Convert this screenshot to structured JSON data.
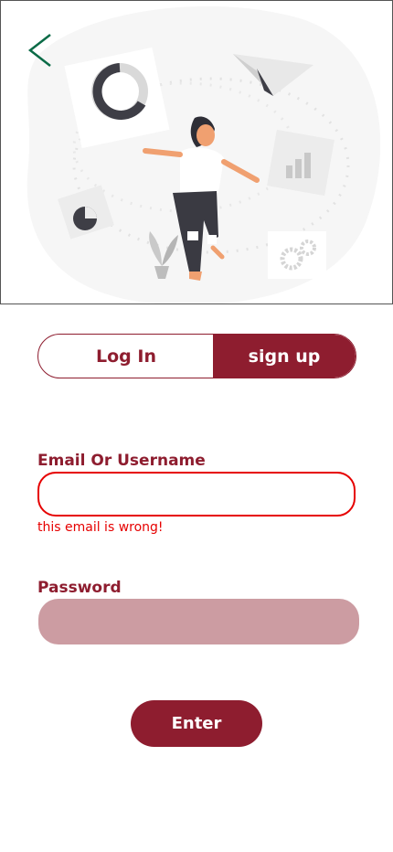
{
  "colors": {
    "brand": "#8e1d2f",
    "error": "#e60000",
    "password_fill": "#cc9ca2",
    "back_icon": "#0b6b47"
  },
  "illustration": {
    "icon": "woman-dancing-with-charts-illustration"
  },
  "back": {
    "icon": "chevron-left-icon"
  },
  "auth_toggle": {
    "login_label": "Log In",
    "signup_label": "sign up",
    "active": "sign up"
  },
  "form": {
    "email_label": "Email Or Username",
    "email_value": "",
    "email_error": "this email is wrong!",
    "password_label": "Password",
    "password_value": ""
  },
  "submit": {
    "label": "Enter"
  }
}
